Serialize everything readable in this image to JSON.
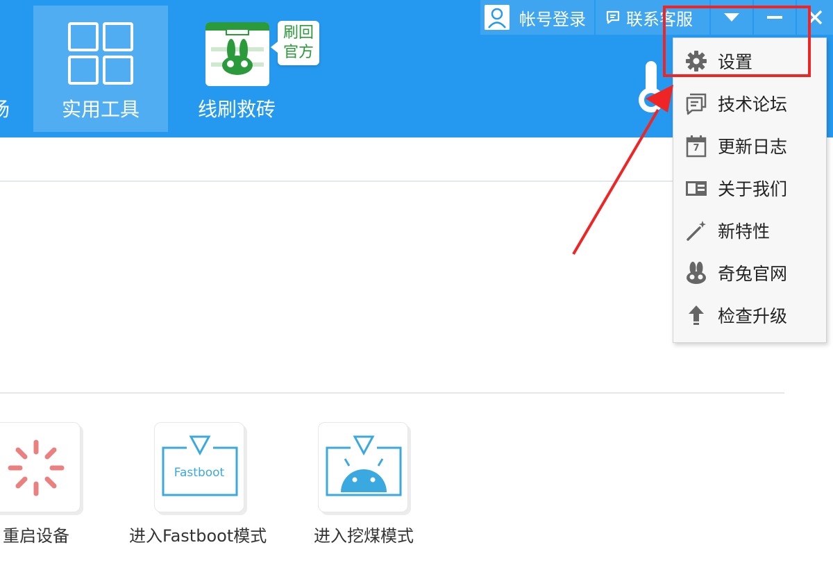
{
  "header": {
    "nav": {
      "market_label": "场",
      "tools_label": "实用工具",
      "flash_label": "线刷救砖",
      "flash_badge": "刷回官方"
    },
    "topbar": {
      "login_label": "帐号登录",
      "contact_label": "联系客服"
    }
  },
  "tools": [
    {
      "label": "重启设备"
    },
    {
      "label": "进入Fastboot模式",
      "icon_text": "Fastboot"
    },
    {
      "label": "进入挖煤模式"
    }
  ],
  "menu": {
    "items": [
      {
        "label": "设置",
        "icon": "gear-icon"
      },
      {
        "label": "技术论坛",
        "icon": "forum-icon"
      },
      {
        "label": "更新日志",
        "icon": "calendar-icon",
        "icon_text": "7"
      },
      {
        "label": "关于我们",
        "icon": "id-card-icon"
      },
      {
        "label": "新特性",
        "icon": "magic-wand-icon"
      },
      {
        "label": "奇兔官网",
        "icon": "rabbit-icon"
      },
      {
        "label": "检查升级",
        "icon": "arrow-up-icon"
      }
    ]
  },
  "colors": {
    "header_bg": "#2599ef",
    "highlight": "#ef2424",
    "accent_blue": "#3aa9e0",
    "restart_red": "#ea8080",
    "brand_green": "#2a9a3a"
  }
}
